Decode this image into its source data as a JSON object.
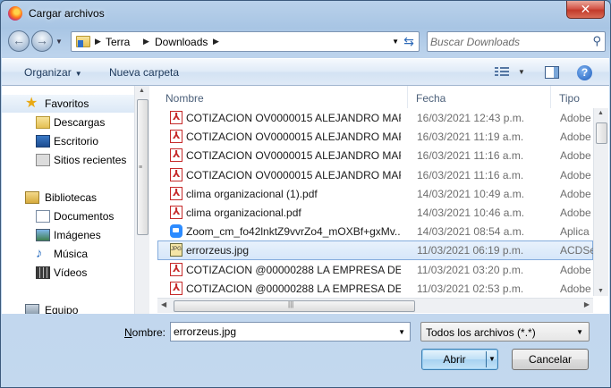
{
  "window": {
    "title": "Cargar archivos",
    "close_label": "✕"
  },
  "nav": {
    "back_icon": "back-arrow-icon",
    "forward_icon": "forward-arrow-icon",
    "breadcrumb": [
      "Terra",
      "Downloads"
    ],
    "search_placeholder": "Buscar Downloads"
  },
  "toolbar": {
    "organize_label": "Organizar",
    "new_folder_label": "Nueva carpeta"
  },
  "sidebar": {
    "items": [
      {
        "label": "Favoritos",
        "icon": "star-icon",
        "type": "group"
      },
      {
        "label": "Descargas",
        "icon": "downloads-folder-icon",
        "type": "child"
      },
      {
        "label": "Escritorio",
        "icon": "desktop-icon",
        "type": "child"
      },
      {
        "label": "Sitios recientes",
        "icon": "recent-places-icon",
        "type": "child"
      },
      {
        "label": "Bibliotecas",
        "icon": "libraries-icon",
        "type": "group"
      },
      {
        "label": "Documentos",
        "icon": "documents-icon",
        "type": "child"
      },
      {
        "label": "Imágenes",
        "icon": "pictures-icon",
        "type": "child"
      },
      {
        "label": "Música",
        "icon": "music-icon",
        "type": "child"
      },
      {
        "label": "Vídeos",
        "icon": "videos-icon",
        "type": "child"
      },
      {
        "label": "Equipo",
        "icon": "computer-icon",
        "type": "group"
      }
    ]
  },
  "columns": {
    "name": "Nombre",
    "date": "Fecha",
    "type": "Tipo"
  },
  "files": [
    {
      "name": "COTIZACION OV0000015 ALEJANDRO MAR...",
      "date": "16/03/2021 12:43 p.m.",
      "type": "Adobe",
      "icon": "pdf"
    },
    {
      "name": "COTIZACION OV0000015 ALEJANDRO MAR...",
      "date": "16/03/2021 11:19 a.m.",
      "type": "Adobe",
      "icon": "pdf"
    },
    {
      "name": "COTIZACION OV0000015 ALEJANDRO MAR...",
      "date": "16/03/2021 11:16 a.m.",
      "type": "Adobe",
      "icon": "pdf"
    },
    {
      "name": "COTIZACION OV0000015 ALEJANDRO MAR...",
      "date": "16/03/2021 11:16 a.m.",
      "type": "Adobe",
      "icon": "pdf"
    },
    {
      "name": "clima organizacional (1).pdf",
      "date": "14/03/2021 10:49 a.m.",
      "type": "Adobe",
      "icon": "pdf"
    },
    {
      "name": "clima organizacional.pdf",
      "date": "14/03/2021 10:46 a.m.",
      "type": "Adobe",
      "icon": "pdf"
    },
    {
      "name": "Zoom_cm_fo42lnktZ9vvrZo4_mOXBf+gxMv...",
      "date": "14/03/2021 08:54 a.m.",
      "type": "Aplica",
      "icon": "zoom"
    },
    {
      "name": "errorzeus.jpg",
      "date": "11/03/2021 06:19 p.m.",
      "type": "ACDSe",
      "icon": "jpg",
      "selected": true
    },
    {
      "name": "COTIZACION @00000288 LA EMPRESA DE A...",
      "date": "11/03/2021 03:20 p.m.",
      "type": "Adobe",
      "icon": "pdf"
    },
    {
      "name": "COTIZACION @00000288 LA EMPRESA DE A...",
      "date": "11/03/2021 02:53 p.m.",
      "type": "Adobe",
      "icon": "pdf"
    }
  ],
  "footer": {
    "filename_label": "Nombre:",
    "filename_value": "errorzeus.jpg",
    "filter_value": "Todos los archivos (*.*)",
    "open_label": "Abrir",
    "cancel_label": "Cancelar"
  }
}
